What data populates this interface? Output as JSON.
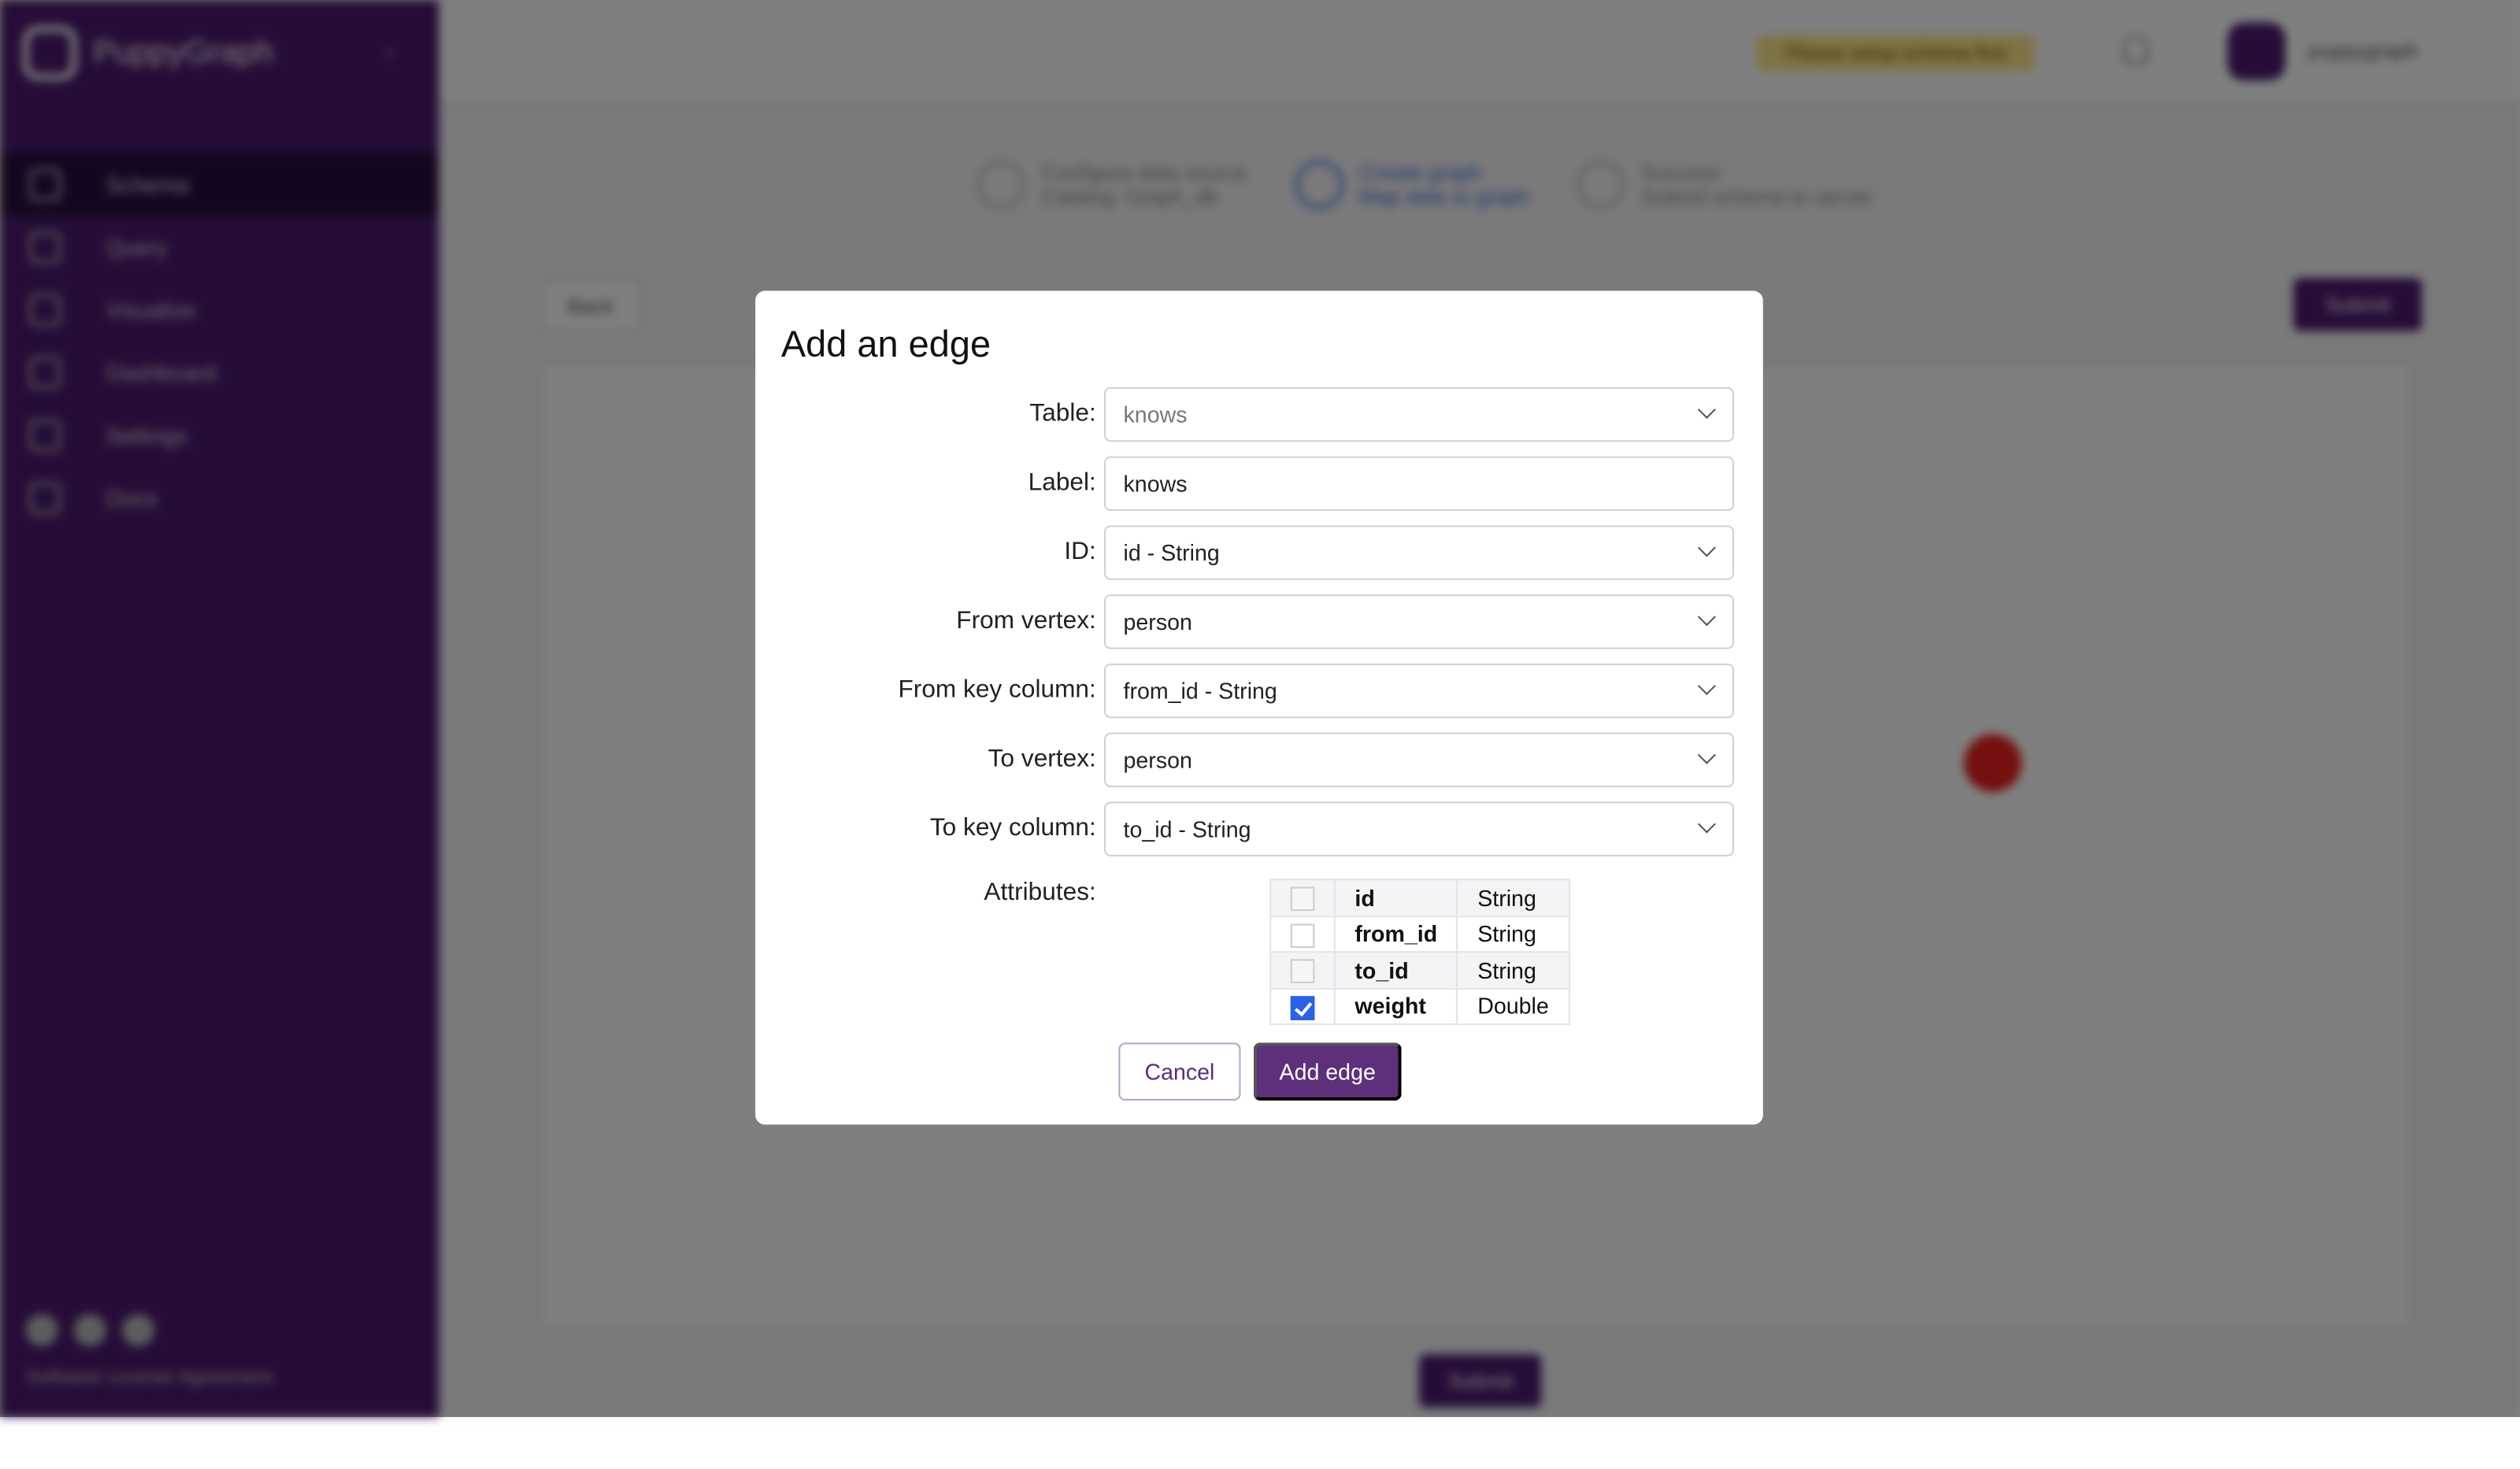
{
  "app": {
    "name": "PuppyGraph",
    "user": "puppygraph",
    "warning": "Please setup schema first"
  },
  "sidebar": {
    "items": [
      {
        "label": "Schema"
      },
      {
        "label": "Query"
      },
      {
        "label": "Visualize"
      },
      {
        "label": "Dashboard"
      },
      {
        "label": "Settings"
      },
      {
        "label": "Docs"
      }
    ],
    "footer": "Software License Agreement"
  },
  "steps": [
    {
      "title": "Configure data source",
      "sub": "Catalog: Graph_db"
    },
    {
      "title": "Create graph",
      "sub": "Map data to graph"
    },
    {
      "title": "Success",
      "sub": "Submit schema to server"
    }
  ],
  "buttons": {
    "back": "Back",
    "submit": "Submit"
  },
  "modal": {
    "title": "Add an edge",
    "fields": [
      {
        "label": "Table:",
        "value": "knows",
        "type": "select",
        "disabled": true
      },
      {
        "label": "Label:",
        "value": "knows",
        "type": "text"
      },
      {
        "label": "ID:",
        "value": "id - String",
        "type": "select"
      },
      {
        "label": "From vertex:",
        "value": "person",
        "type": "select"
      },
      {
        "label": "From key column:",
        "value": "from_id - String",
        "type": "select"
      },
      {
        "label": "To vertex:",
        "value": "person",
        "type": "select"
      },
      {
        "label": "To key column:",
        "value": "to_id - String",
        "type": "select"
      }
    ],
    "attributes_label": "Attributes:",
    "attributes": [
      {
        "name": "id",
        "type": "String",
        "checked": false
      },
      {
        "name": "from_id",
        "type": "String",
        "checked": false
      },
      {
        "name": "to_id",
        "type": "String",
        "checked": false
      },
      {
        "name": "weight",
        "type": "Double",
        "checked": true
      }
    ],
    "cancel": "Cancel",
    "confirm": "Add edge"
  },
  "colors": {
    "brand": "#4a1a6e",
    "primary_button": "#5e2f7a",
    "checkbox": "#2a62e6",
    "warning": "#fbe78a"
  }
}
